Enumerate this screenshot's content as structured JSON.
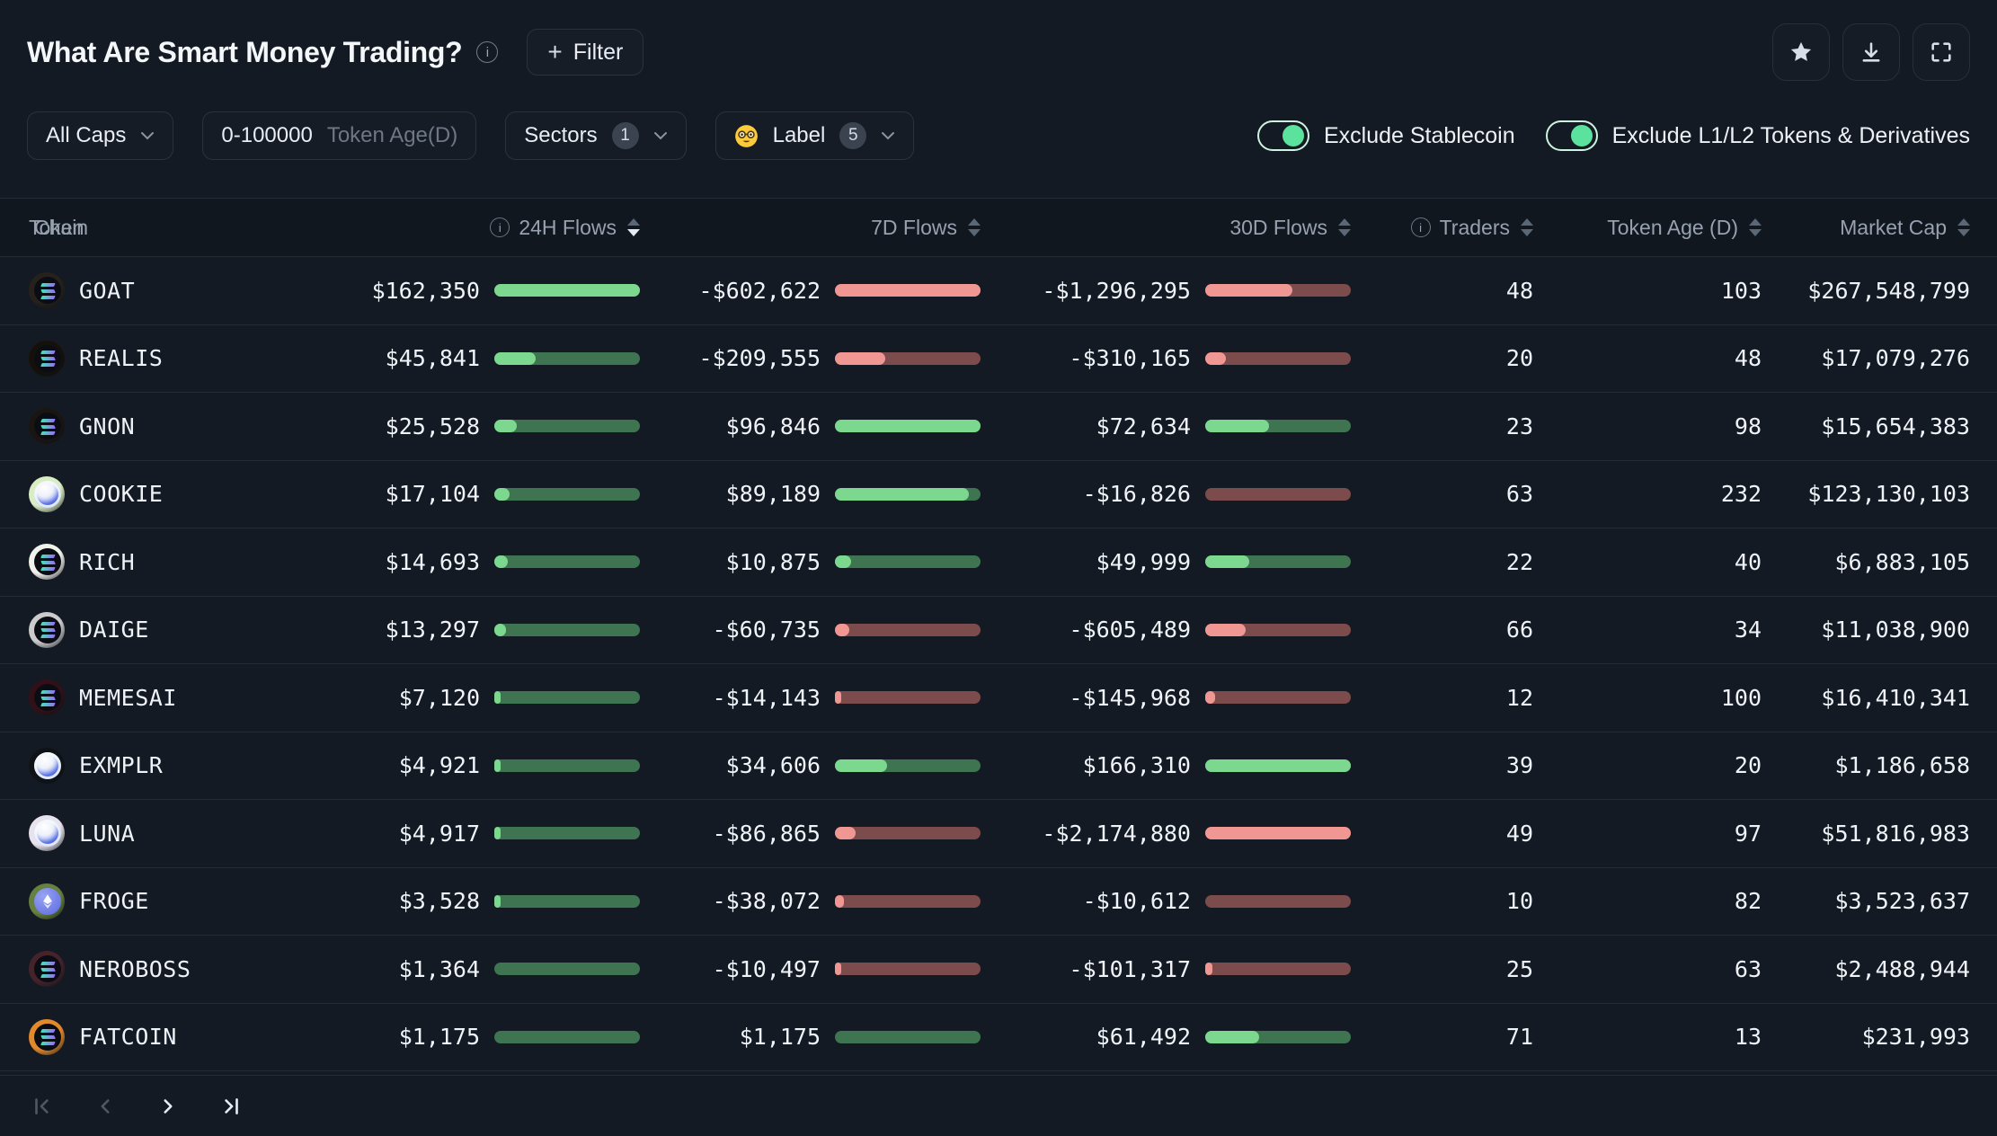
{
  "header": {
    "title": "What Are Smart Money Trading?",
    "filter_button_plus": "+",
    "filter_button_label": "Filter"
  },
  "filters": {
    "all_caps": {
      "label": "All Caps"
    },
    "token_age": {
      "value": "0-100000",
      "suffix": "Token Age(D)"
    },
    "sectors": {
      "label": "Sectors",
      "count": "1"
    },
    "label_filter": {
      "label": "Label",
      "count": "5"
    },
    "toggles": [
      {
        "label": "Exclude Stablecoin",
        "on": true
      },
      {
        "label": "Exclude L1/L2 Tokens & Derivatives",
        "on": true
      }
    ]
  },
  "table": {
    "columns": [
      {
        "key": "chain",
        "label": "Chain",
        "align": "left"
      },
      {
        "key": "token",
        "label": "Token",
        "align": "left"
      },
      {
        "key": "f24",
        "label": "24H Flows",
        "align": "right",
        "info": true,
        "sortable": true,
        "sort": "desc"
      },
      {
        "key": "f7",
        "label": "7D Flows",
        "align": "right",
        "sortable": true
      },
      {
        "key": "f30",
        "label": "30D Flows",
        "align": "right",
        "sortable": true
      },
      {
        "key": "traders",
        "label": "Traders",
        "align": "right",
        "info": true,
        "sortable": true
      },
      {
        "key": "age",
        "label": "Token Age (D)",
        "align": "right",
        "sortable": true
      },
      {
        "key": "mcap",
        "label": "Market Cap",
        "align": "right",
        "sortable": true
      }
    ],
    "rows": [
      {
        "chain": "solana",
        "token": "GOAT",
        "icon_bg": "#26211B",
        "icon_fg": "#B59B6A",
        "icon_glyph": "G",
        "f24": {
          "text": "$162,350",
          "pct": 100,
          "dir": "pos"
        },
        "f7": {
          "text": "-$602,622",
          "pct": 100,
          "dir": "neg"
        },
        "f30": {
          "text": "-$1,296,295",
          "pct": 59.6,
          "dir": "neg"
        },
        "traders": "48",
        "age": "103",
        "mcap": "$267,548,799"
      },
      {
        "chain": "solana",
        "token": "REALIS",
        "icon_bg": "#15110A",
        "icon_fg": "#D4B05A",
        "icon_glyph": "R",
        "f24": {
          "text": "$45,841",
          "pct": 28.2,
          "dir": "pos"
        },
        "f7": {
          "text": "-$209,555",
          "pct": 34.8,
          "dir": "neg"
        },
        "f30": {
          "text": "-$310,165",
          "pct": 14.3,
          "dir": "neg"
        },
        "traders": "20",
        "age": "48",
        "mcap": "$17,079,276"
      },
      {
        "chain": "solana",
        "token": "GNON",
        "icon_bg": "#1B1511",
        "icon_fg": "#C79A52",
        "icon_glyph": "G",
        "f24": {
          "text": "$25,528",
          "pct": 15.7,
          "dir": "pos"
        },
        "f7": {
          "text": "$96,846",
          "pct": 100,
          "dir": "pos"
        },
        "f30": {
          "text": "$72,634",
          "pct": 43.7,
          "dir": "pos"
        },
        "traders": "23",
        "age": "98",
        "mcap": "$15,654,383"
      },
      {
        "chain": "orb",
        "token": "COOKIE",
        "icon_bg": "#D9EDC5",
        "icon_fg": "#232D1E",
        "icon_glyph": "C",
        "f24": {
          "text": "$17,104",
          "pct": 10.5,
          "dir": "pos"
        },
        "f7": {
          "text": "$89,189",
          "pct": 92.1,
          "dir": "pos"
        },
        "f30": {
          "text": "-$16,826",
          "pct": 0.8,
          "dir": "neg"
        },
        "traders": "63",
        "age": "232",
        "mcap": "$123,130,103"
      },
      {
        "chain": "solana",
        "token": "RICH",
        "icon_bg": "#F1F1EB",
        "icon_fg": "#4A4A46",
        "icon_glyph": "R",
        "f24": {
          "text": "$14,693",
          "pct": 9.1,
          "dir": "pos"
        },
        "f7": {
          "text": "$10,875",
          "pct": 11.2,
          "dir": "pos"
        },
        "f30": {
          "text": "$49,999",
          "pct": 30.1,
          "dir": "pos"
        },
        "traders": "22",
        "age": "40",
        "mcap": "$6,883,105"
      },
      {
        "chain": "solana",
        "token": "DAIGE",
        "icon_bg": "#CBCBCB",
        "icon_fg": "#2F2F2F",
        "icon_glyph": "D",
        "f24": {
          "text": "$13,297",
          "pct": 8.2,
          "dir": "pos"
        },
        "f7": {
          "text": "-$60,735",
          "pct": 10.1,
          "dir": "neg"
        },
        "f30": {
          "text": "-$605,489",
          "pct": 27.8,
          "dir": "neg"
        },
        "traders": "66",
        "age": "34",
        "mcap": "$11,038,900"
      },
      {
        "chain": "solana",
        "token": "MEMESAI",
        "icon_bg": "#331017",
        "icon_fg": "#D24A50",
        "icon_glyph": "M",
        "f24": {
          "text": "$7,120",
          "pct": 4.4,
          "dir": "pos"
        },
        "f7": {
          "text": "-$14,143",
          "pct": 2.3,
          "dir": "neg"
        },
        "f30": {
          "text": "-$145,968",
          "pct": 6.7,
          "dir": "neg"
        },
        "traders": "12",
        "age": "100",
        "mcap": "$16,410,341"
      },
      {
        "chain": "orb",
        "token": "EXMPLR",
        "icon_bg": "#101316",
        "icon_fg": "#E6E9EC",
        "icon_glyph": "E",
        "f24": {
          "text": "$4,921",
          "pct": 3,
          "dir": "pos"
        },
        "f7": {
          "text": "$34,606",
          "pct": 35.7,
          "dir": "pos"
        },
        "f30": {
          "text": "$166,310",
          "pct": 100,
          "dir": "pos"
        },
        "traders": "39",
        "age": "20",
        "mcap": "$1,186,658"
      },
      {
        "chain": "orb",
        "token": "LUNA",
        "icon_bg": "#E7E3EE",
        "icon_fg": "#8F9AC2",
        "icon_glyph": "L",
        "f24": {
          "text": "$4,917",
          "pct": 3,
          "dir": "pos"
        },
        "f7": {
          "text": "-$86,865",
          "pct": 14.4,
          "dir": "neg"
        },
        "f30": {
          "text": "-$2,174,880",
          "pct": 100,
          "dir": "neg"
        },
        "traders": "49",
        "age": "97",
        "mcap": "$51,816,983"
      },
      {
        "chain": "ethereum",
        "token": "FROGE",
        "icon_bg": "#66813F",
        "icon_fg": "#2E4220",
        "icon_glyph": "F",
        "f24": {
          "text": "$3,528",
          "pct": 2.2,
          "dir": "pos"
        },
        "f7": {
          "text": "-$38,072",
          "pct": 6.3,
          "dir": "neg"
        },
        "f30": {
          "text": "-$10,612",
          "pct": 0.5,
          "dir": "neg"
        },
        "traders": "10",
        "age": "82",
        "mcap": "$3,523,637"
      },
      {
        "chain": "solana",
        "token": "NEROBOSS",
        "icon_bg": "#46232B",
        "icon_fg": "#C98A56",
        "icon_glyph": "N",
        "f24": {
          "text": "$1,364",
          "pct": 0.8,
          "dir": "pos"
        },
        "f7": {
          "text": "-$10,497",
          "pct": 1.7,
          "dir": "neg"
        },
        "f30": {
          "text": "-$101,317",
          "pct": 4.7,
          "dir": "neg"
        },
        "traders": "25",
        "age": "63",
        "mcap": "$2,488,944"
      },
      {
        "chain": "solana",
        "token": "FATCOIN",
        "icon_bg": "#E2892C",
        "icon_fg": "#5E3211",
        "icon_glyph": "F",
        "f24": {
          "text": "$1,175",
          "pct": 0.7,
          "dir": "pos"
        },
        "f7": {
          "text": "$1,175",
          "pct": 0.9,
          "dir": "pos"
        },
        "f30": {
          "text": "$61,492",
          "pct": 37,
          "dir": "pos"
        },
        "traders": "71",
        "age": "13",
        "mcap": "$231,993"
      }
    ]
  },
  "pagination": {
    "buttons": [
      {
        "name": "first",
        "enabled": false
      },
      {
        "name": "prev",
        "enabled": false
      },
      {
        "name": "next",
        "enabled": true
      },
      {
        "name": "last",
        "enabled": true
      }
    ]
  },
  "colors": {
    "accent_green": "#5BE39E",
    "bar_green": "#7CD78F",
    "bar_green_track": "#3E7450",
    "bar_red": "#F09693",
    "bar_red_track": "#7C4B4B",
    "background": "#141A23"
  }
}
